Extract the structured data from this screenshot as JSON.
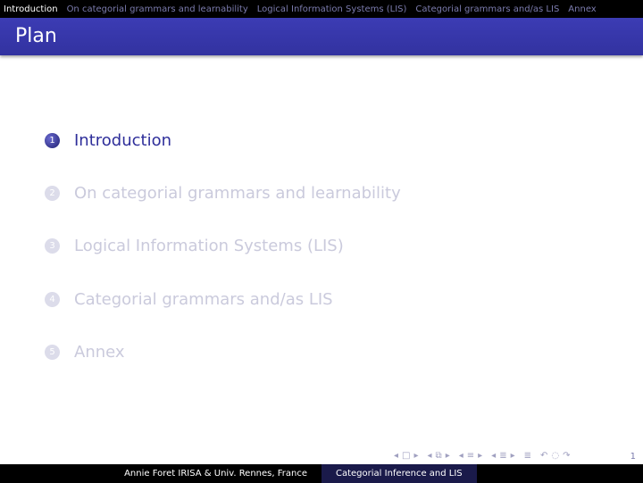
{
  "nav": {
    "items": [
      "Introduction",
      "On categorial grammars and learnability",
      "Logical Information Systems (LIS)",
      "Categorial grammars and/as LIS",
      "Annex"
    ]
  },
  "slide": {
    "title": "Plan"
  },
  "toc": [
    {
      "num": "1",
      "label": "Introduction"
    },
    {
      "num": "2",
      "label": "On categorial grammars and learnability"
    },
    {
      "num": "3",
      "label": "Logical Information Systems (LIS)"
    },
    {
      "num": "4",
      "label": "Categorial grammars and/as LIS"
    },
    {
      "num": "5",
      "label": "Annex"
    }
  ],
  "footer": {
    "author": "Annie Foret IRISA & Univ. Rennes, France",
    "title": "Categorial Inference and LIS"
  },
  "page_number": "1",
  "colors": {
    "title_bar": "#3434a8",
    "active_text": "#2e2e9a",
    "inactive_text": "#cacadc",
    "nav_inactive": "#7b7bad"
  }
}
